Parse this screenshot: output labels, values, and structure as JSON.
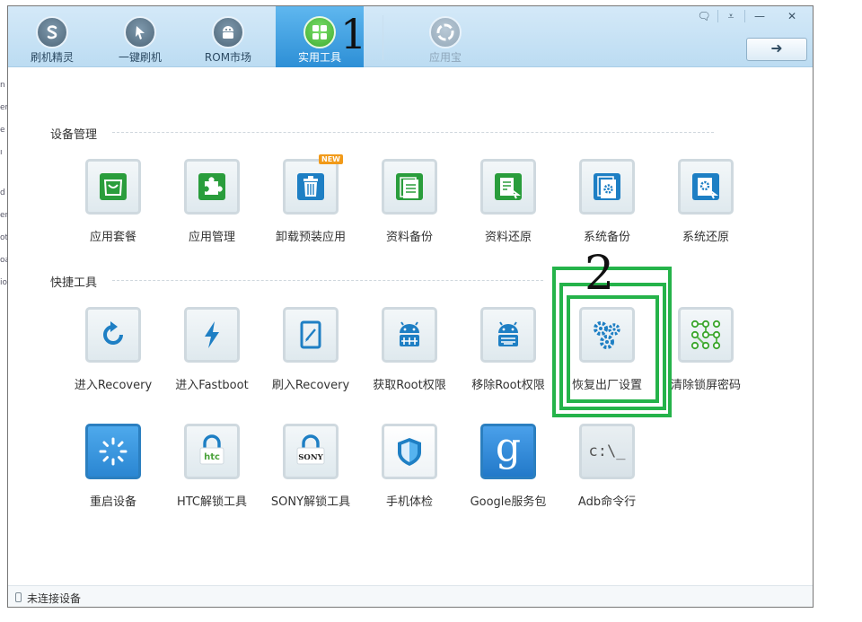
{
  "window": {
    "tabs": [
      {
        "label": "刷机精灵",
        "icon": "shuaji-logo-icon",
        "state": "normal"
      },
      {
        "label": "一键刷机",
        "icon": "cursor-icon",
        "state": "normal"
      },
      {
        "label": "ROM市场",
        "icon": "android-icon",
        "state": "normal"
      },
      {
        "label": "实用工具",
        "icon": "grid-icon",
        "state": "active"
      },
      {
        "label": "应用宝",
        "icon": "yingyongbao-icon",
        "state": "disabled"
      }
    ],
    "annotation_1": "1",
    "controls": {
      "feedback": "🗨",
      "menu": "⩡",
      "minimize": "—",
      "close": "✕"
    },
    "action_button": "➜"
  },
  "sections": [
    {
      "title": "设备管理"
    },
    {
      "title": "快捷工具"
    }
  ],
  "tools": {
    "device": [
      {
        "label": "应用套餐",
        "icon": "shopping-bag-icon"
      },
      {
        "label": "应用管理",
        "icon": "puzzle-icon"
      },
      {
        "label": "卸载预装应用",
        "icon": "trash-icon",
        "badge": "NEW"
      },
      {
        "label": "资料备份",
        "icon": "document-backup-icon"
      },
      {
        "label": "资料还原",
        "icon": "document-restore-icon"
      },
      {
        "label": "系统备份",
        "icon": "system-backup-icon"
      },
      {
        "label": "系统还原",
        "icon": "system-restore-icon"
      }
    ],
    "quick_row1": [
      {
        "label": "进入Recovery",
        "icon": "refresh-icon"
      },
      {
        "label": "进入Fastboot",
        "icon": "lightning-icon"
      },
      {
        "label": "刷入Recovery",
        "icon": "tablet-icon"
      },
      {
        "label": "获取Root权限",
        "icon": "android-root-icon"
      },
      {
        "label": "移除Root权限",
        "icon": "android-unroot-icon"
      },
      {
        "label": "恢复出厂设置",
        "icon": "gears-icon"
      },
      {
        "label": "清除锁屏密码",
        "icon": "pattern-lock-icon"
      }
    ],
    "quick_row2": [
      {
        "label": "重启设备",
        "icon": "loading-spinner-icon"
      },
      {
        "label": "HTC解锁工具",
        "icon": "htc-lock-icon",
        "brand": "htc"
      },
      {
        "label": "SONY解锁工具",
        "icon": "sony-lock-icon",
        "brand": "SONY"
      },
      {
        "label": "手机体检",
        "icon": "shield-icon"
      },
      {
        "label": "Google服务包",
        "icon": "google-icon",
        "glyph": "g"
      },
      {
        "label": "Adb命令行",
        "icon": "terminal-icon",
        "glyph": "c:\\_"
      }
    ]
  },
  "annotation_2": "2",
  "status": {
    "text": "未连接设备",
    "icon": "phone-icon"
  },
  "colors": {
    "accent": "#2d8fd6",
    "highlight": "#25b34a",
    "icon_blue": "#1e7fc4",
    "icon_green": "#2a9d3c"
  }
}
